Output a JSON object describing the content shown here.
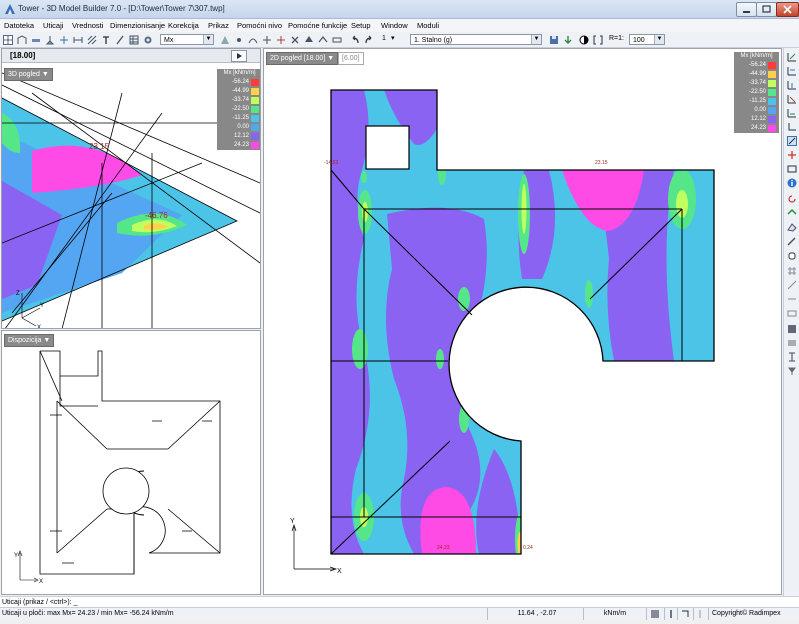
{
  "window": {
    "title": "Tower - 3D Model Builder 7.0 - [D:\\Tower\\Tower 7\\307.twp]"
  },
  "menu": [
    "Datoteka",
    "Uticaji",
    "Vrednosti",
    "Dimenzionisanje",
    "Korekcija",
    "Prikaz",
    "Pomoćni nivo",
    "Pomoćne funkcije",
    "Setup",
    "Window",
    "Moduli"
  ],
  "toolbar": {
    "result_combo": "Mx",
    "load_case_number": "1",
    "load_case_combo": "1. Stalno (g)",
    "ratio_label": "R=1:",
    "ratio_value": "100"
  },
  "left_top": {
    "header_value": "[18.00]",
    "view_tag": "3D pogled",
    "label_max": "23.15",
    "label_min": "-46.76"
  },
  "left_bottom": {
    "view_tag": "Dispozicija"
  },
  "main": {
    "view_tag": "2D pogled  [18.00]",
    "secondary_tag": "[6.00]",
    "label_top_left": "-14.53",
    "label_top_mid": "23.15",
    "label_bottom_mid": "24.23",
    "label_bottom_right": "0.24"
  },
  "legend": {
    "title": "Mx [kNm/m]",
    "entries": [
      {
        "value": "-56.24",
        "color": "#ff3b3b"
      },
      {
        "value": "-44.99",
        "color": "#ffd24a"
      },
      {
        "value": "-33.74",
        "color": "#bfff60"
      },
      {
        "value": "-22.50",
        "color": "#56e68a"
      },
      {
        "value": "-11.25",
        "color": "#4cc4e8"
      },
      {
        "value": "0.00",
        "color": "#55a6f2"
      },
      {
        "value": "12.12",
        "color": "#8a63f2"
      },
      {
        "value": "24.23",
        "color": "#ff4be6"
      }
    ]
  },
  "axes": {
    "x": "X",
    "y": "Y",
    "z": "Z"
  },
  "status": {
    "command": "Uticaji (prikaz / <ctrl>): _",
    "info": "Uticaji u ploči: max Mx= 24.23 / min Mx= -56.24 kNm/m",
    "coords": "11.64 , -2.07",
    "units": "kNm/m",
    "copyright": "Copyright© Radimpex"
  }
}
